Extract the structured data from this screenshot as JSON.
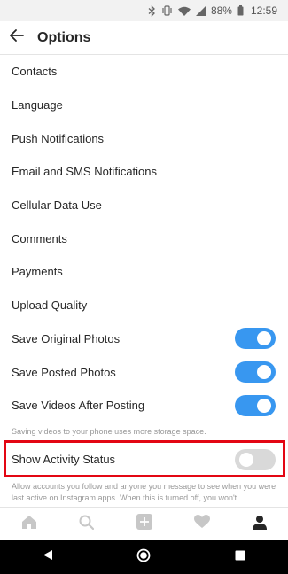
{
  "status_bar": {
    "battery": "88%",
    "time": "12:59",
    "icons": [
      "bluetooth-icon",
      "vibrate-icon",
      "wifi-icon",
      "signal-icon",
      "battery-icon"
    ]
  },
  "header": {
    "title": "Options",
    "back_icon": "arrow-left-icon"
  },
  "menu": {
    "items": [
      {
        "label": "Contacts"
      },
      {
        "label": "Language"
      },
      {
        "label": "Push Notifications"
      },
      {
        "label": "Email and SMS Notifications"
      },
      {
        "label": "Cellular Data Use"
      },
      {
        "label": "Comments"
      },
      {
        "label": "Payments"
      },
      {
        "label": "Upload Quality"
      }
    ],
    "toggles": [
      {
        "label": "Save Original Photos",
        "on": true
      },
      {
        "label": "Save Posted Photos",
        "on": true
      },
      {
        "label": "Save Videos After Posting",
        "on": true
      }
    ],
    "videos_note": "Saving videos to your phone uses more storage space."
  },
  "activity": {
    "label": "Show Activity Status",
    "on": false,
    "note": "Allow accounts you follow and anyone you message to see when you were last active on Instagram apps. When this is turned off, you won't"
  },
  "bottom_nav": [
    "home-icon",
    "search-icon",
    "add-icon",
    "heart-icon",
    "profile-icon"
  ],
  "system_nav": [
    "back-triangle-icon",
    "home-circle-icon",
    "recents-square-icon"
  ],
  "colors": {
    "accent": "#3897f0",
    "highlight": "#e30613",
    "toggle_off": "#d9d9d9"
  }
}
